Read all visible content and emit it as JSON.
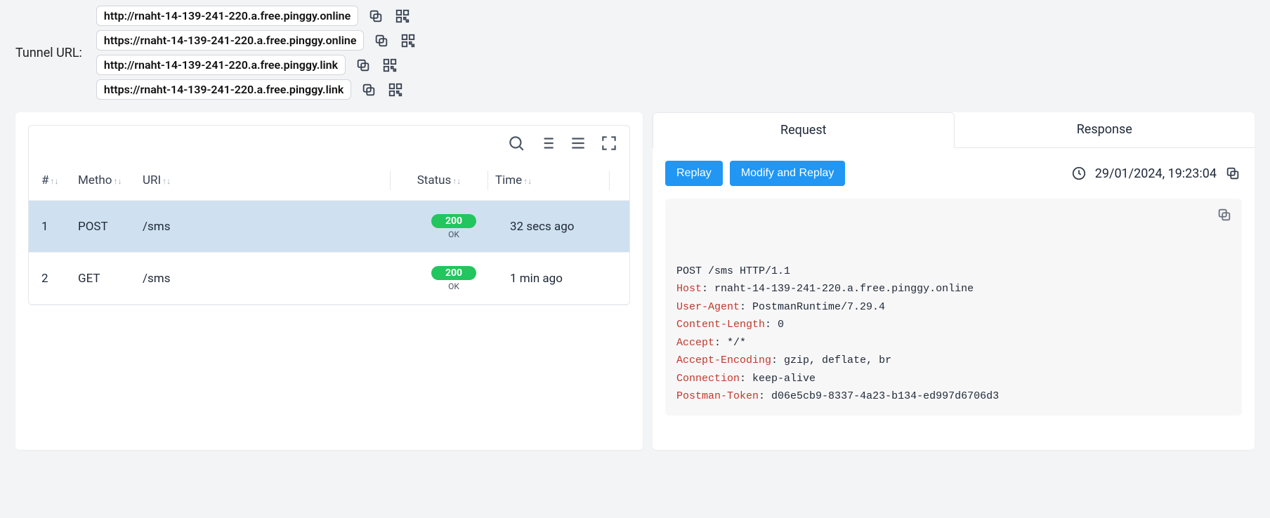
{
  "tunnel": {
    "label": "Tunnel URL:",
    "urls": [
      "http://rnaht-14-139-241-220.a.free.pinggy.online",
      "https://rnaht-14-139-241-220.a.free.pinggy.online",
      "http://rnaht-14-139-241-220.a.free.pinggy.link",
      "https://rnaht-14-139-241-220.a.free.pinggy.link"
    ]
  },
  "table": {
    "headers": {
      "num": "#",
      "method": "Metho",
      "uri": "URI",
      "status": "Status",
      "time": "Time"
    },
    "rows": [
      {
        "num": "1",
        "method": "POST",
        "uri": "/sms",
        "status_code": "200",
        "status_text": "OK",
        "time": "32 secs ago",
        "selected": true
      },
      {
        "num": "2",
        "method": "GET",
        "uri": "/sms",
        "status_code": "200",
        "status_text": "OK",
        "time": "1 min ago",
        "selected": false
      }
    ]
  },
  "detail": {
    "tabs": {
      "request": "Request",
      "response": "Response"
    },
    "buttons": {
      "replay": "Replay",
      "modify_replay": "Modify and Replay"
    },
    "timestamp": "29/01/2024, 19:23:04",
    "request_line": "POST /sms HTTP/1.1",
    "headers": [
      {
        "key": "Host",
        "value": "rnaht-14-139-241-220.a.free.pinggy.online"
      },
      {
        "key": "User-Agent",
        "value": "PostmanRuntime/7.29.4"
      },
      {
        "key": "Content-Length",
        "value": "0"
      },
      {
        "key": "Accept",
        "value": "*/*"
      },
      {
        "key": "Accept-Encoding",
        "value": "gzip, deflate, br"
      },
      {
        "key": "Connection",
        "value": "keep-alive"
      },
      {
        "key": "Postman-Token",
        "value": "d06e5cb9-8337-4a23-b134-ed997d6706d3"
      }
    ]
  }
}
